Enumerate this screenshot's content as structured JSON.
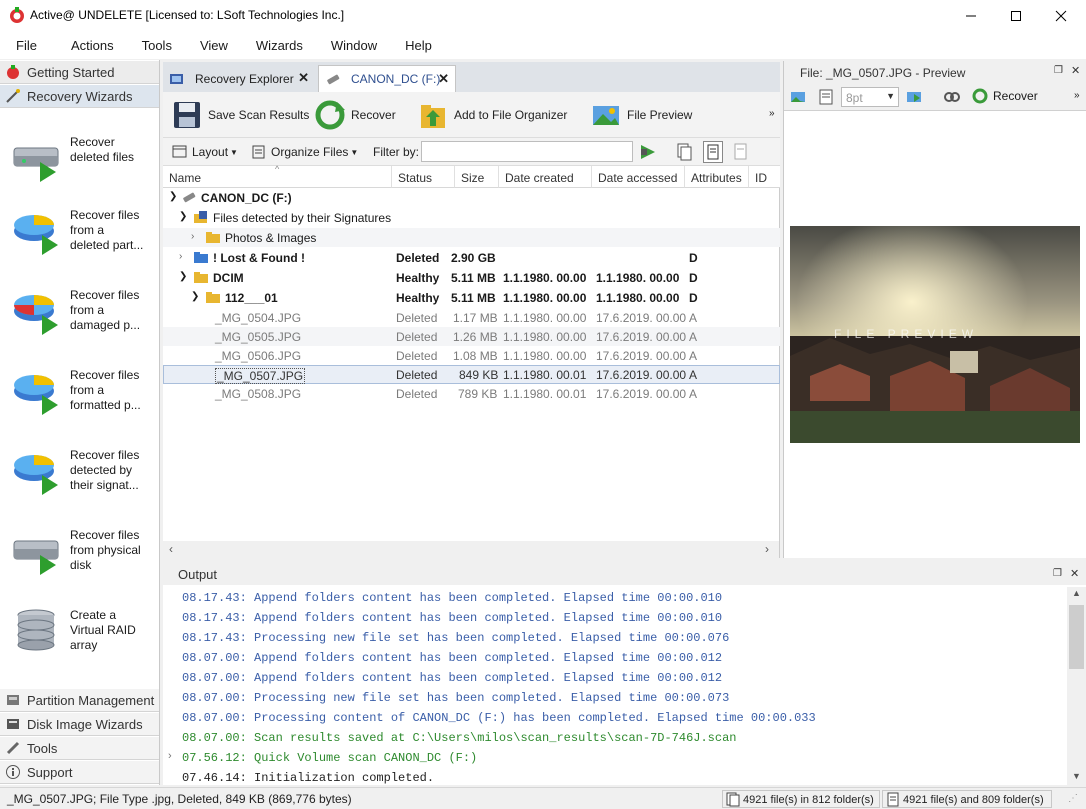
{
  "window": {
    "title": "Active@ UNDELETE [Licensed to: LSoft Technologies Inc.]"
  },
  "menu": [
    "File",
    "Actions",
    "Tools",
    "View",
    "Wizards",
    "Window",
    "Help"
  ],
  "left_panel": {
    "getting_started": "Getting Started",
    "recovery_wizards": "Recovery Wizards",
    "wizards": [
      "Recover\ndeleted files",
      "Recover files\nfrom a\ndeleted part...",
      "Recover files\nfrom a\ndamaged p...",
      "Recover files\nfrom a\nformatted p...",
      "Recover files\ndetected by\ntheir signat...",
      "Recover files\nfrom physical\ndisk",
      "Create a\nVirtual RAID\narray"
    ],
    "bottom": [
      "Partition Management",
      "Disk Image Wizards",
      "Tools",
      "Support"
    ]
  },
  "tabs": [
    {
      "label": "Recovery Explorer"
    },
    {
      "label": "CANON_DC (F:)"
    }
  ],
  "toolbar": {
    "save": "Save Scan Results",
    "recover": "Recover",
    "add": "Add to File Organizer",
    "preview": "File Preview",
    "layout": "Layout",
    "organize": "Organize Files",
    "filter_label": "Filter by:",
    "filter_value": ""
  },
  "columns": [
    "Name",
    "Status",
    "Size",
    "Date created",
    "Date accessed",
    "Attributes",
    "ID"
  ],
  "rows": [
    {
      "name": "CANON_DC (F:)",
      "status": "",
      "size": "",
      "created": "",
      "accessed": "",
      "attr": ""
    },
    {
      "name": "Files detected by their Signatures",
      "status": "",
      "size": "",
      "created": "",
      "accessed": "",
      "attr": ""
    },
    {
      "name": "Photos & Images",
      "status": "",
      "size": "",
      "created": "",
      "accessed": "",
      "attr": ""
    },
    {
      "name": "! Lost & Found !",
      "status": "Deleted",
      "size": "2.90 GB",
      "created": "",
      "accessed": "",
      "attr": "D"
    },
    {
      "name": "DCIM",
      "status": "Healthy",
      "size": "5.11 MB",
      "created": "1.1.1980. 00.00",
      "accessed": "1.1.1980. 00.00",
      "attr": "D"
    },
    {
      "name": "112___01",
      "status": "Healthy",
      "size": "5.11 MB",
      "created": "1.1.1980. 00.00",
      "accessed": "1.1.1980. 00.00",
      "attr": "D"
    },
    {
      "name": "_MG_0504.JPG",
      "status": "Deleted",
      "size": "1.17 MB",
      "created": "1.1.1980. 00.00",
      "accessed": "17.6.2019. 00.00",
      "attr": "A"
    },
    {
      "name": "_MG_0505.JPG",
      "status": "Deleted",
      "size": "1.26 MB",
      "created": "1.1.1980. 00.00",
      "accessed": "17.6.2019. 00.00",
      "attr": "A"
    },
    {
      "name": "_MG_0506.JPG",
      "status": "Deleted",
      "size": "1.08 MB",
      "created": "1.1.1980. 00.00",
      "accessed": "17.6.2019. 00.00",
      "attr": "A"
    },
    {
      "name": "_MG_0507.JPG",
      "status": "Deleted",
      "size": "849 KB",
      "created": "1.1.1980. 00.01",
      "accessed": "17.6.2019. 00.00",
      "attr": "A"
    },
    {
      "name": "_MG_0508.JPG",
      "status": "Deleted",
      "size": "789 KB",
      "created": "1.1.1980. 00.01",
      "accessed": "17.6.2019. 00.00",
      "attr": "A"
    }
  ],
  "preview": {
    "title": "File: _MG_0507.JPG - Preview",
    "font_size": "8pt",
    "recover": "Recover",
    "watermark": "FILE PREVIEW"
  },
  "output": {
    "title": "Output",
    "lines": [
      "08.17.43: Append folders content has been completed. Elapsed time 00:00.010",
      "08.17.43: Append folders content has been completed. Elapsed time 00:00.010",
      "08.17.43: Processing new file set has been completed. Elapsed time 00:00.076",
      "08.07.00: Append folders content has been completed. Elapsed time 00:00.012",
      "08.07.00: Append folders content has been completed. Elapsed time 00:00.012",
      "08.07.00: Processing new file set has been completed. Elapsed time 00:00.073",
      "08.07.00: Processing content of CANON_DC (F:) has been completed. Elapsed time 00:00.033",
      "08.07.00: Scan results saved at C:\\Users\\milos\\scan_results\\scan-7D-746J.scan",
      "07.56.12: Quick Volume scan CANON_DC (F:)",
      "07.46.14: Initialization completed."
    ]
  },
  "status": {
    "left": "_MG_0507.JPG; File Type .jpg, Deleted, 849 KB (869,776 bytes)",
    "box1": "4921 file(s) in 812 folder(s)",
    "box2": "4921 file(s) and 809 folder(s)"
  },
  "colors": {
    "accent": "#3a5ea8",
    "green": "#2e8a2e",
    "selection": "#e9eef6"
  }
}
